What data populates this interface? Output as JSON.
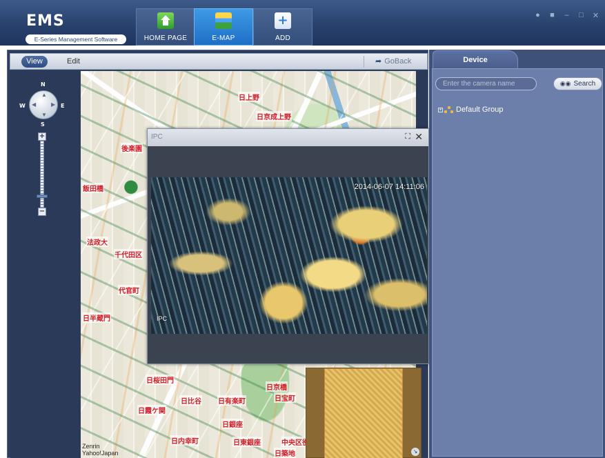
{
  "app": {
    "logo_title": "EMS",
    "logo_subtitle": "E-Series Management Software"
  },
  "nav_tabs": [
    {
      "label": "HOME PAGE",
      "icon": "home-icon",
      "active": false
    },
    {
      "label": "E-MAP",
      "icon": "map-icon",
      "active": true
    },
    {
      "label": "ADD",
      "icon": "add-icon",
      "active": false
    }
  ],
  "window_controls": [
    "user-icon",
    "lock-icon",
    "minimize-icon",
    "maximize-icon",
    "close-icon"
  ],
  "map_toolbar": {
    "view_label": "View",
    "edit_label": "Edit",
    "goback_label": "GoBack"
  },
  "map_nav": {
    "north": "N",
    "south": "S",
    "west": "W",
    "east": "E",
    "zoom_in": "+",
    "zoom_out": "−"
  },
  "map_labels": [
    "日上野",
    "日京成上野",
    "後楽園",
    "飯田橋",
    "法政大",
    "千代田区",
    "代官町",
    "日半蔵門",
    "日桜田門",
    "日有楽町",
    "日比谷",
    "日京橋",
    "日宝町",
    "日銀座",
    "日霞ケ関",
    "日内幸町",
    "日東銀座",
    "日築地",
    "中央区役"
  ],
  "map_credit": {
    "line1": "Zenrin",
    "line2": "Yahoo!Japan"
  },
  "video_popup": {
    "title": "IPC",
    "timestamp": "2014-06-07 14:11:06",
    "camera_label": "IPC",
    "maximize_glyph": "⛶",
    "close_glyph": "✕"
  },
  "device_panel": {
    "tab_label": "Device",
    "search_placeholder": "Enter the camera name",
    "search_button": "Search",
    "tree": [
      {
        "label": "Default Group",
        "expandable": true
      }
    ]
  },
  "colors": {
    "topbar": "#27406a",
    "active_tab": "#1e6fc6",
    "panel": "#6c7eaa",
    "map_label_red": "#d31f2a"
  }
}
